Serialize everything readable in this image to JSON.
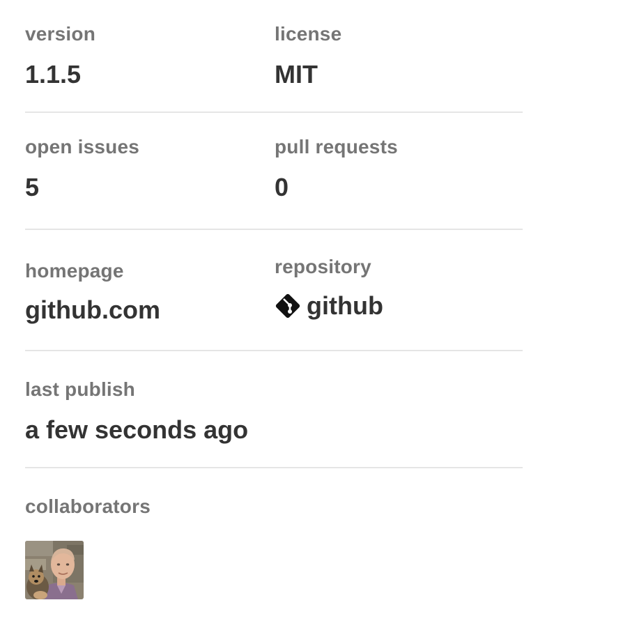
{
  "details": {
    "version": {
      "label": "version",
      "value": "1.1.5"
    },
    "license": {
      "label": "license",
      "value": "MIT"
    },
    "open_issues": {
      "label": "open issues",
      "value": "5"
    },
    "pull_requests": {
      "label": "pull requests",
      "value": "0"
    },
    "homepage": {
      "label": "homepage",
      "value": "github.com"
    },
    "repository": {
      "label": "repository",
      "value": "github",
      "icon": "git-icon"
    },
    "last_publish": {
      "label": "last publish",
      "value": "a few seconds ago"
    },
    "collaborators": {
      "label": "collaborators",
      "items": [
        {
          "icon": "avatar"
        }
      ]
    }
  },
  "colors": {
    "label": "#757575",
    "value": "#333333",
    "divider": "#e5e5e5",
    "background": "#ffffff"
  }
}
